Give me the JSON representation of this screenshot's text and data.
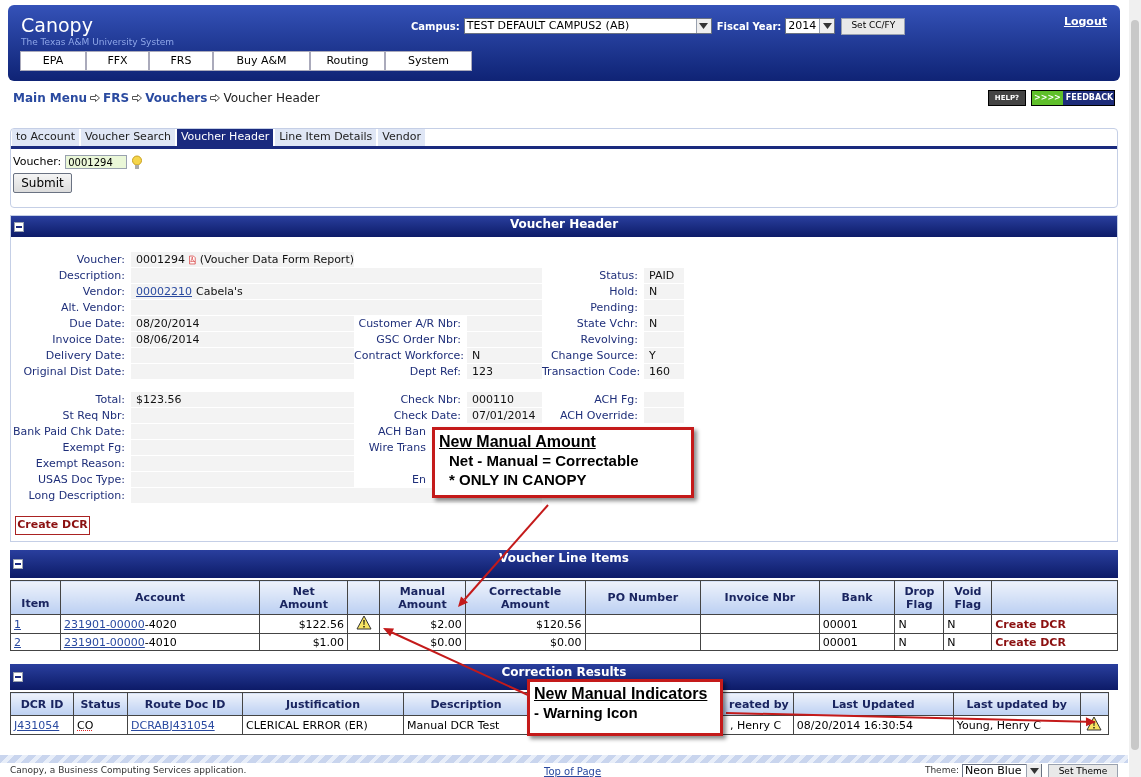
{
  "header": {
    "title": "Canopy",
    "subtitle": "The Texas A&M University System",
    "campus_label": "Campus:",
    "campus_value": "TEST DEFAULT CAMPUS2 (AB)",
    "fiscal_year_label": "Fiscal Year:",
    "fiscal_year_value": "2014",
    "set_button": "Set CC/FY",
    "logout": "Logout"
  },
  "nav": [
    "EPA",
    "FFX",
    "FRS",
    "Buy A&M",
    "Routing",
    "System"
  ],
  "breadcrumb": [
    {
      "label": "Main Menu",
      "link": true
    },
    {
      "label": "FRS",
      "link": true
    },
    {
      "label": "Vouchers",
      "link": true
    },
    {
      "label": "Voucher Header",
      "link": false
    }
  ],
  "help_button": "HELP?",
  "feedback_button": {
    "arrows": ">>>>",
    "label": "FEEDBACK"
  },
  "tabs": [
    {
      "label": "to Account",
      "selected": false
    },
    {
      "label": "Voucher Search",
      "selected": false
    },
    {
      "label": "Voucher Header",
      "selected": true
    },
    {
      "label": "Line Item Details",
      "selected": false
    },
    {
      "label": "Vendor",
      "selected": false
    }
  ],
  "voucher_form": {
    "label": "Voucher:",
    "value": "0001294",
    "submit": "Submit"
  },
  "voucher_header": {
    "title": "Voucher Header",
    "groups": [
      [
        {
          "wide": false,
          "left": {
            "label": "Voucher:",
            "value": "0001294",
            "note": "(Voucher Data Form Report)"
          }
        },
        {
          "wide": true,
          "left": {
            "label": "Description:"
          },
          "right": {
            "label": "Status:",
            "value": "PAID"
          }
        },
        {
          "wide": true,
          "left": {
            "label": "Vendor:",
            "link": "00002210",
            "value": "Cabela's"
          },
          "right": {
            "label": "Hold:",
            "value": "N"
          }
        },
        {
          "wide": true,
          "left": {
            "label": "Alt. Vendor:"
          },
          "right": {
            "label": "Pending:"
          }
        },
        {
          "wide": false,
          "left": {
            "label": "Due Date:",
            "value": "08/20/2014"
          },
          "middle": {
            "label": "Customer A/R Nbr:"
          },
          "right": {
            "label": "State Vchr:",
            "value": "N"
          }
        },
        {
          "wide": false,
          "left": {
            "label": "Invoice Date:",
            "value": "08/06/2014"
          },
          "middle": {
            "label": "GSC Order Nbr:"
          },
          "right": {
            "label": "Revolving:"
          }
        },
        {
          "wide": false,
          "left": {
            "label": "Delivery Date:"
          },
          "middle": {
            "label": "Contract Workforce:",
            "value": "N"
          },
          "right": {
            "label": "Change Source:",
            "value": "Y"
          }
        },
        {
          "wide": false,
          "left": {
            "label": "Original Dist Date:"
          },
          "middle": {
            "label": "Dept Ref:",
            "value": "123"
          },
          "right": {
            "label": "Transaction Code:",
            "value": "160"
          }
        }
      ],
      [
        {
          "wide": false,
          "left": {
            "label": "Total:",
            "value": "$123.56"
          },
          "middle": {
            "label": "Check Nbr:",
            "value": "000110"
          },
          "right": {
            "label": "ACH Fg:"
          }
        },
        {
          "wide": false,
          "left": {
            "label": "St Req Nbr:"
          },
          "middle": {
            "label": "Check Date:",
            "value": "07/01/2014"
          },
          "right": {
            "label": "ACH Override:"
          }
        },
        {
          "wide": false,
          "left": {
            "label": "Bank Paid Chk Date:"
          },
          "middle": {
            "label": "ACH Ban",
            "covered": true
          }
        },
        {
          "wide": false,
          "left": {
            "label": "Exempt Fg:"
          },
          "middle": {
            "label": "Wire Trans",
            "covered": true
          }
        },
        {
          "wide": false,
          "left": {
            "label": "Exempt Reason:"
          }
        },
        {
          "wide": false,
          "left": {
            "label": "USAS Doc Type:"
          },
          "middle": {
            "label": "En",
            "covered": true
          }
        },
        {
          "wide": true,
          "left": {
            "label": "Long Description:"
          }
        }
      ]
    ],
    "create_dcr": "Create DCR"
  },
  "line_items": {
    "title": "Voucher Line Items",
    "columns": [
      [
        "Item"
      ],
      [
        "Account"
      ],
      [
        "Net",
        "Amount"
      ],
      [],
      [
        "Manual",
        "Amount"
      ],
      [
        "Correctable",
        "Amount"
      ],
      [
        "PO Number"
      ],
      [
        "Invoice Nbr"
      ],
      [
        "Bank"
      ],
      [
        "Drop",
        "Flag"
      ],
      [
        "Void",
        "Flag"
      ],
      []
    ],
    "rows": [
      {
        "item": "1",
        "account_link": "231901-00000",
        "account_suffix": "-4020",
        "net": "$122.56",
        "warning": true,
        "manual": "$2.00",
        "correctable": "$120.56",
        "bank": "00001",
        "drop": "N",
        "void": "N",
        "action": "Create DCR"
      },
      {
        "item": "2",
        "account_link": "231901-00000",
        "account_suffix": "-4010",
        "net": "$1.00",
        "warning": false,
        "manual": "$0.00",
        "correctable": "$0.00",
        "bank": "00001",
        "drop": "N",
        "void": "N",
        "action": "Create DCR"
      }
    ]
  },
  "corrections": {
    "title": "Correction Results",
    "columns": [
      "DCR ID",
      "Status",
      "Route Doc ID",
      "Justification",
      "Description",
      null,
      "reated by",
      "Last Updated",
      "Last updated by",
      null
    ],
    "rows": [
      {
        "dcr_id": "J431054",
        "status": "CO",
        "route_doc": "DCRABJ431054",
        "justification": "CLERICAL ERROR (ER)",
        "description": "Manual DCR Test",
        "created_by": ", Henry C",
        "last_updated": "08/20/2014 16:30:54",
        "last_updated_by": "Young, Henry C",
        "warning": true
      }
    ]
  },
  "callouts": [
    {
      "title": "New Manual Amount",
      "lines": [
        "Net - Manual = Correctable",
        "* ONLY IN CANOPY"
      ]
    },
    {
      "title": "New Manual Indicators",
      "lines": [
        "- Warning Icon"
      ]
    }
  ],
  "footer": {
    "text": "Canopy, a Business Computing Services application.",
    "top_link": "Top of Page",
    "theme_label": "Theme:",
    "theme_value": "Neon Blue",
    "set_theme": "Set Theme"
  }
}
